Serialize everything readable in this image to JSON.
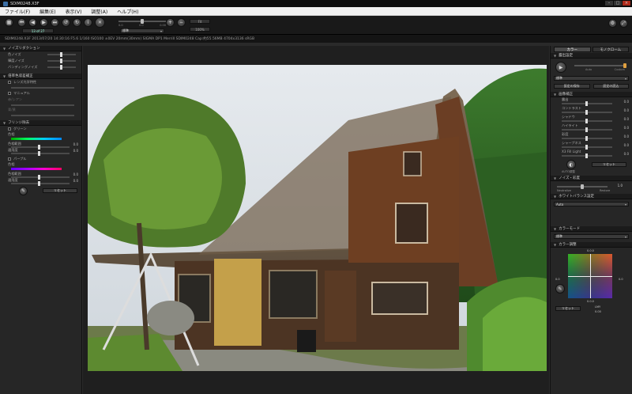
{
  "window": {
    "title": "SDIM0248.X3F",
    "controls": [
      "–",
      "□",
      "×"
    ]
  },
  "menu": [
    "ファイル(F)",
    "編集(E)",
    "表示(V)",
    "調整(A)",
    "ヘルプ(H)"
  ],
  "toolbar": {
    "filename_display": "SDIM0248.X3F",
    "counter": "13 of 27",
    "mode_dropdown": "標準",
    "slider_labels": [
      "0.0",
      "0.0",
      "0.00"
    ],
    "zoom_value": "Fit",
    "right_value": "100%"
  },
  "info": {
    "text": "SDIM0248.X3F 2013/07/20 14:30:16 F5.6 1/160 ISO100 ±0EV 20mm(30mm) SIGMA DP1 Merrill SDIM0248  Cap:約55.56MB 4704x3136 sRGB"
  },
  "left": {
    "noise": {
      "title": "ノイズリダクション",
      "rows": [
        {
          "label": "色ノイズ",
          "value": ""
        },
        {
          "label": "輝度ノイズ",
          "value": ""
        },
        {
          "label": "バンディングノイズ",
          "value": ""
        }
      ]
    },
    "lens": {
      "title": "倍率色収差補正",
      "rows": [
        {
          "label": "レンズ光学特性",
          "value": ""
        },
        {
          "label": "マニュアル",
          "value": ""
        },
        {
          "label": "赤/シアン",
          "value": ""
        },
        {
          "label": "青/黄",
          "value": ""
        }
      ]
    },
    "fringe": {
      "title": "フリンジ除去",
      "green": {
        "label": "グリーン",
        "hue": "色相",
        "range": "色相範囲",
        "amount": "適用度",
        "range_value": "0.0",
        "amount_value": "0.0"
      },
      "purple": {
        "label": "パープル",
        "hue": "色相",
        "range": "色相範囲",
        "amount": "適用度",
        "range_value": "0.0",
        "amount_value": "0.0"
      },
      "reset": "リセット"
    }
  },
  "right": {
    "tabs": [
      "カラー",
      "モノクローム"
    ],
    "wb": {
      "title": "露出設定",
      "labels": [
        "Auto",
        "Custom"
      ],
      "mode": "標準",
      "btn_save": "設定の保存",
      "btn_load": "設定の読込"
    },
    "tone": {
      "title": "画像補正",
      "rows": [
        {
          "label": "露出",
          "value": "0.0"
        },
        {
          "label": "コントラスト",
          "value": "0.0"
        },
        {
          "label": "シャドウ",
          "value": "0.0"
        },
        {
          "label": "ハイライト",
          "value": "0.0"
        },
        {
          "label": "彩度",
          "value": "0.0"
        },
        {
          "label": "シャープネス",
          "value": "0.0"
        },
        {
          "label": "X3 Fill Light",
          "value": "0.0"
        }
      ],
      "auto": "AUTO調整",
      "reset": "リセット"
    },
    "ns": {
      "title": "ノイズ・彩度",
      "value": "1.0",
      "left": "Neutralize",
      "right": "Restore"
    },
    "wbset": {
      "title": "ホワイトバランス設定",
      "mode": "Auto"
    },
    "colormode": {
      "title": "カラーモード",
      "mode": "標準"
    },
    "colorwheel": {
      "title": "カラー調整",
      "top": "0.0.0",
      "left": "0.0",
      "right": "0.0",
      "bottom": "0.0.0",
      "reset": "リセット",
      "readout_label": "LMY",
      "readout_value": "0.00"
    }
  }
}
